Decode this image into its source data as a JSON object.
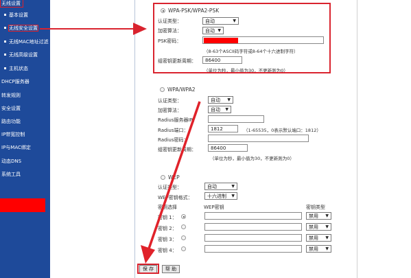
{
  "sidebar": {
    "items": [
      {
        "label": "无线设置",
        "bullet": false
      },
      {
        "label": "基本设置",
        "bullet": true
      },
      {
        "label": "无线安全设置",
        "bullet": true
      },
      {
        "label": "无线MAC地址过滤",
        "bullet": true
      },
      {
        "label": "无线高级设置",
        "bullet": true
      },
      {
        "label": "主机状态",
        "bullet": true
      },
      {
        "label": "DHCP服务器",
        "bullet": false
      },
      {
        "label": "转发规则",
        "bullet": false
      },
      {
        "label": "安全设置",
        "bullet": false
      },
      {
        "label": "路由功能",
        "bullet": false
      },
      {
        "label": "IP带宽控制",
        "bullet": false
      },
      {
        "label": "IP与MAC绑定",
        "bullet": false
      },
      {
        "label": "动态DNS",
        "bullet": false
      },
      {
        "label": "系统工具",
        "bullet": false
      }
    ]
  },
  "wpa_psk": {
    "title": "WPA-PSK/WPA2-PSK",
    "auth_label": "认证类型：",
    "auth_value": "自动",
    "enc_label": "加密算法：",
    "enc_value": "自动",
    "psk_label": "PSK密码：",
    "psk_hint": "（8-63个ASCII码字符或8-64个十六进制字符）",
    "renew_label": "组密钥更新周期：",
    "renew_value": "86400",
    "renew_hint": "（单位为秒，最小值为30，不更新则为0）"
  },
  "wpa": {
    "title": "WPA/WPA2",
    "auth_label": "认证类型：",
    "auth_value": "自动",
    "enc_label": "加密算法：",
    "enc_value": "自动",
    "radius_ip_label": "Radius服务器IP：",
    "radius_port_label": "Radius端口：",
    "radius_port_value": "1812",
    "radius_port_hint": "（1-65535，0表示默认端口：1812）",
    "radius_pwd_label": "Radius密码：",
    "renew_label": "组密钥更新周期：",
    "renew_value": "86400",
    "renew_hint": "（单位为秒，最小值为30，不更新则为0）"
  },
  "wep": {
    "title": "WEP",
    "auth_label": "认证类型：",
    "auth_value": "自动",
    "format_label": "WEP密钥格式：",
    "format_value": "十六进制",
    "col_select": "密钥选择",
    "col_key": "WEP密钥",
    "col_type": "密钥类型",
    "keys": [
      {
        "label": "密钥 1：",
        "type": "禁用"
      },
      {
        "label": "密钥 2：",
        "type": "禁用"
      },
      {
        "label": "密钥 3：",
        "type": "禁用"
      },
      {
        "label": "密钥 4：",
        "type": "禁用"
      }
    ]
  },
  "buttons": {
    "save": "保 存",
    "help": "帮 助"
  },
  "colors": {
    "sidebar_bg": "#1e4a9a",
    "annotation_red": "#d9232e"
  }
}
